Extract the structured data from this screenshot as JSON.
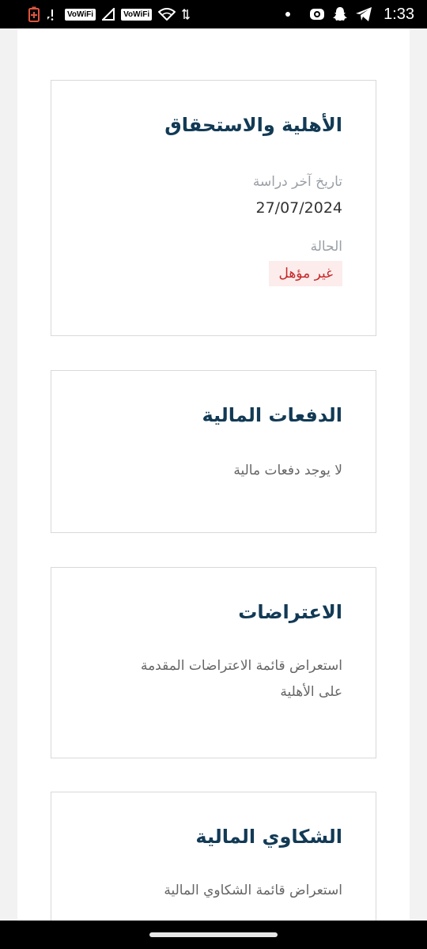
{
  "status_bar": {
    "time": "1:33",
    "vowifi_1": "VoWiFi",
    "vowifi_2": "VoWiFi",
    "icons": [
      "battery-saver-icon",
      "signal-no-data-icon",
      "signal-icon",
      "wifi-icon",
      "dot-icon",
      "record-icon",
      "snapchat-icon",
      "telegram-icon"
    ]
  },
  "cards": {
    "eligibility": {
      "title": "الأهلية والاستحقاق",
      "last_study_label": "تاريخ آخر دراسة",
      "last_study_value": "27/07/2024",
      "status_label": "الحالة",
      "status_value": "غير مؤهل"
    },
    "payments": {
      "title": "الدفعات المالية",
      "description": "لا يوجد دفعات مالية"
    },
    "objections": {
      "title": "الاعتراضات",
      "description_line1": "استعراض قائمة الاعتراضات المقدمة",
      "description_line2": "على الأهلية"
    },
    "complaints": {
      "title": "الشكاوي المالية",
      "description_line1": "استعراض قائمة الشكاوي المالية"
    }
  },
  "colors": {
    "title": "#123a55",
    "badge_bg": "#fdecec",
    "badge_text": "#c62828"
  }
}
